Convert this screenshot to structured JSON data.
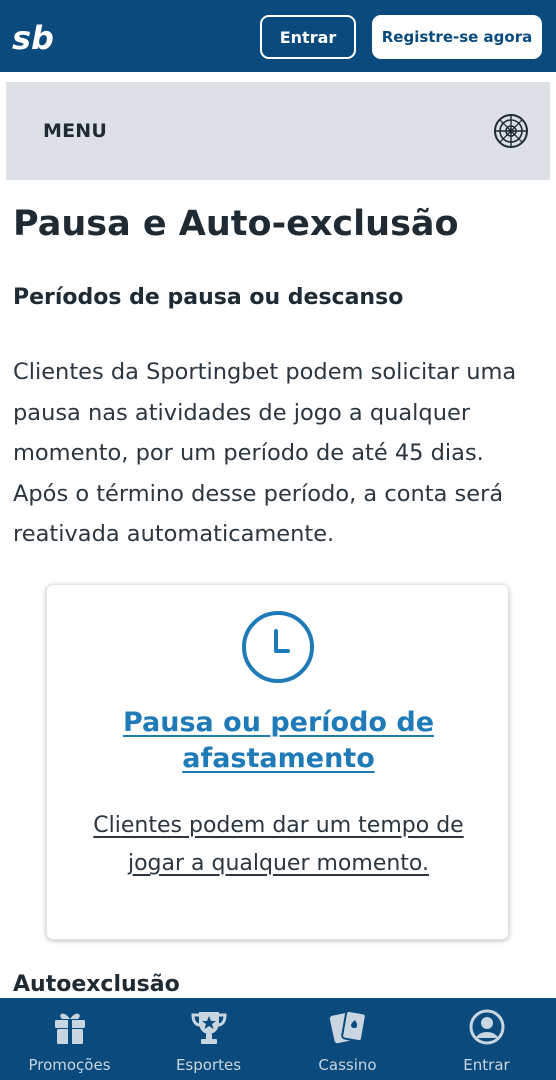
{
  "header": {
    "logo_text": "sb",
    "login_label": "Entrar",
    "register_label": "Registre-se agora"
  },
  "menu": {
    "label": "MENU",
    "icon": "roulette-wheel-icon"
  },
  "content": {
    "page_title": "Pausa e Auto-exclusão",
    "section_title": "Períodos de pausa ou descanso",
    "paragraph": "Clientes da Sportingbet podem solicitar uma pausa nas atividades de jogo a qualquer momento, por um período de até 45 dias. Após o término desse período, a conta será reativada automaticamente.",
    "card": {
      "icon": "clock-icon",
      "title": "Pausa ou período de afastamento",
      "text": "Clientes podem dar um tempo de jogar a qualquer momento."
    },
    "next_section_title": "Autoexclusão"
  },
  "bottom_nav": {
    "items": [
      {
        "label": "Promoções",
        "icon": "gift-icon"
      },
      {
        "label": "Esportes",
        "icon": "trophy-icon"
      },
      {
        "label": "Cassino",
        "icon": "cards-icon"
      },
      {
        "label": "Entrar",
        "icon": "user-icon"
      }
    ]
  },
  "colors": {
    "brand": "#0a4a7c",
    "link": "#1f7ab8",
    "menu_bg": "#dde1e6"
  }
}
